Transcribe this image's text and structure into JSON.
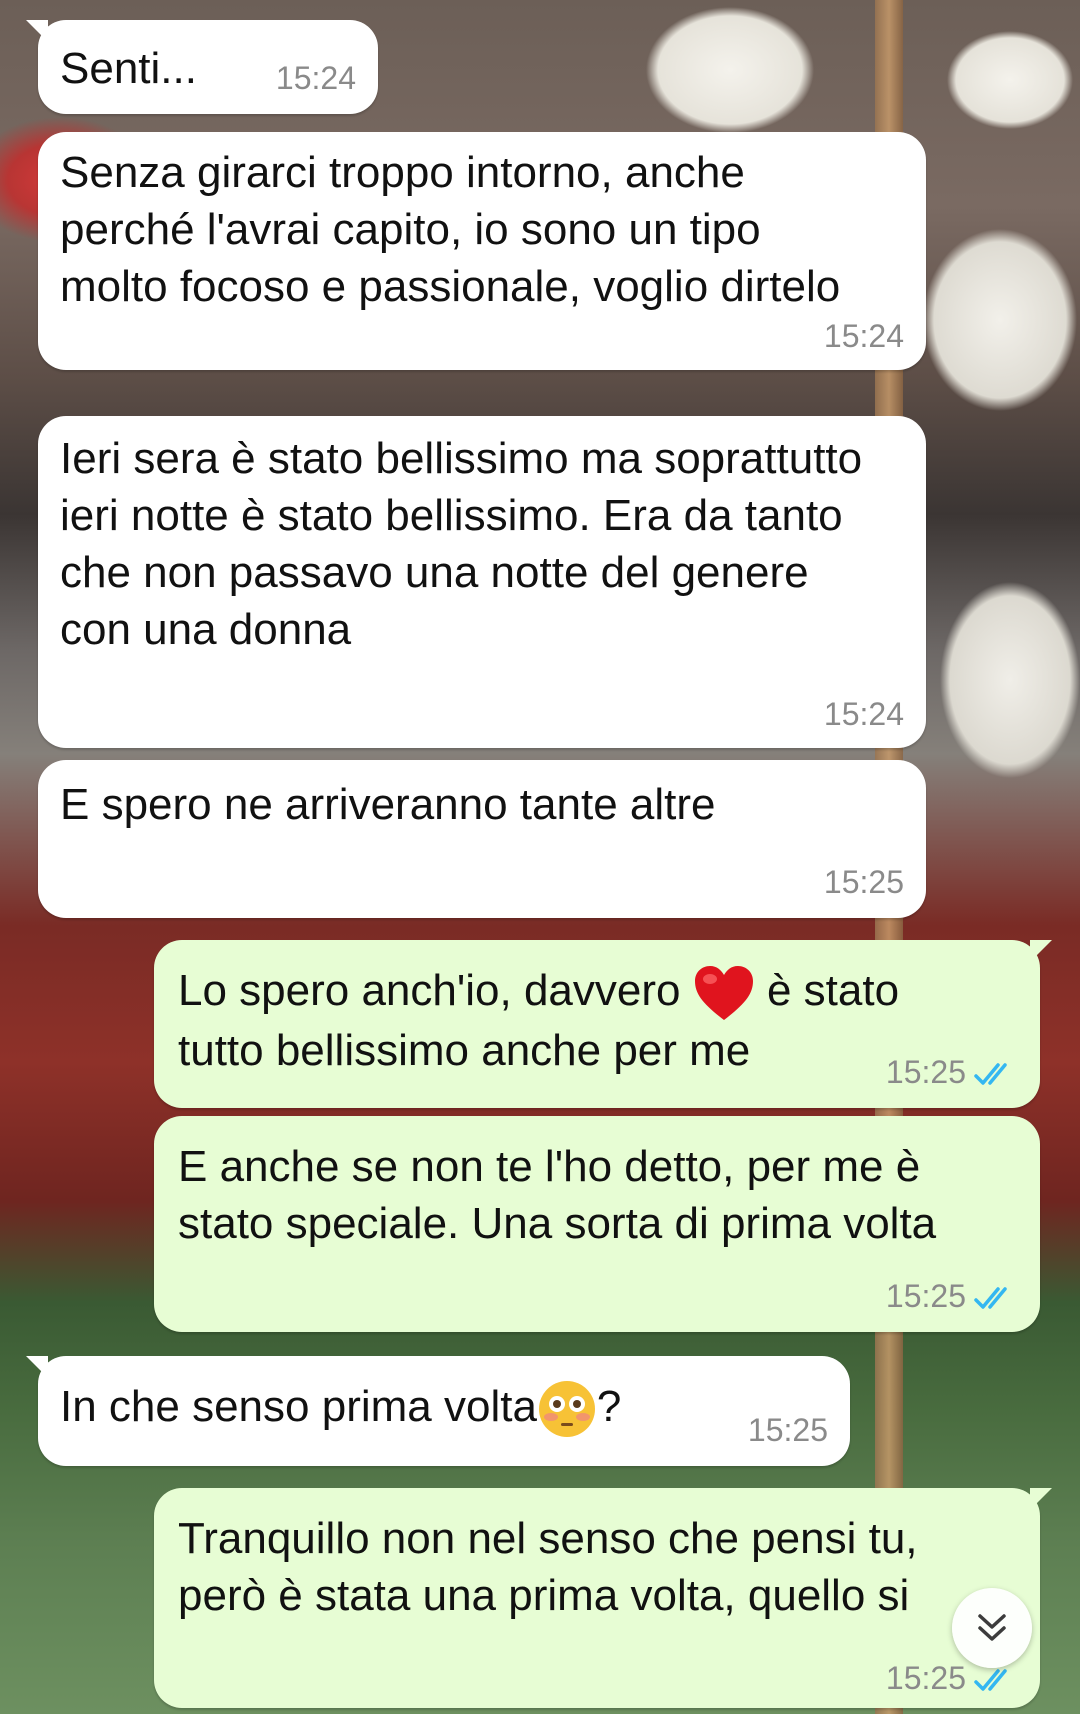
{
  "chat": {
    "messages": [
      {
        "direction": "in",
        "text": "Senti...",
        "time": "15:24"
      },
      {
        "direction": "in",
        "text": "Senza girarci troppo intorno, anche perché l'avrai capito, io sono un tipo molto focoso e passionale, voglio dirtelo",
        "time": "15:24"
      },
      {
        "direction": "in",
        "text": "Ieri sera è stato bellissimo ma soprattutto ieri notte è stato bellissimo. Era da tanto che non passavo una notte del genere con una donna",
        "time": "15:24"
      },
      {
        "direction": "in",
        "text": "E spero ne arriveranno tante altre",
        "time": "15:25"
      },
      {
        "direction": "out",
        "text_before": "Lo spero anch'io, davvero ",
        "emoji": "red-heart",
        "text_after": " è stato tutto bellissimo anche per me",
        "time": "15:25",
        "status": "read"
      },
      {
        "direction": "out",
        "text": "E anche se non te l'ho detto, per me è stato speciale. Una sorta di prima volta",
        "time": "15:25",
        "status": "read"
      },
      {
        "direction": "in",
        "text_before": "In che senso prima volta",
        "emoji": "flushed-face",
        "text_after": "?",
        "time": "15:25"
      },
      {
        "direction": "out",
        "text": "Tranquillo non nel senso che pensi tu, però è stata una prima volta, quello si",
        "time": "15:25",
        "status": "read"
      }
    ]
  },
  "colors": {
    "incoming_bubble": "#ffffff",
    "outgoing_bubble": "#e7fdd4",
    "read_ticks": "#34b7f1",
    "timestamp": "#8a8a8a"
  },
  "icons": {
    "read_status": "double-check-icon",
    "scroll_down": "double-chevron-down-icon"
  }
}
